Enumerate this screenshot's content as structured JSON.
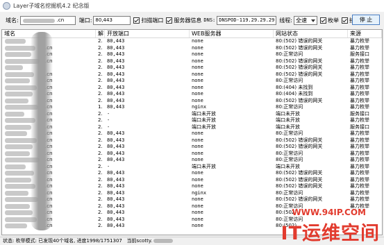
{
  "window": {
    "title": "Layer子域名挖掘机4.2 纪念版"
  },
  "toolbar": {
    "domain_label": "域名:",
    "domain_value": ".cn",
    "port_label": "端口:",
    "port_value": "80,443",
    "scan_ports_label": "扫描端口",
    "server_info_label": "服务器信息",
    "dns_label": "DNS:",
    "dns_value": "DNSPOD-119.29.29.29",
    "threads_label": "线程:",
    "threads_value": "全速",
    "enum_label": "枚举",
    "interface_label": "接口",
    "stop_label": "停 止"
  },
  "table": {
    "columns": [
      "域名",
      "解",
      "开放端口",
      "WEB服务器",
      "网站状态",
      "来源"
    ],
    "rows": [
      {
        "domain": "",
        "ip": "2.",
        "ports": "80,443",
        "server": "none",
        "status": "80:(502) 错误的网关",
        "source": "暴力枚举"
      },
      {
        "domain": ".cn",
        "ip": "2.",
        "ports": "80,443",
        "server": "none",
        "status": "80:(502) 错误的网关",
        "source": "暴力枚举"
      },
      {
        "domain": ".cn",
        "ip": "2.",
        "ports": "80,443",
        "server": "none",
        "status": "80:正常访问",
        "source": "服务接口"
      },
      {
        "domain": ".cn",
        "ip": "2.",
        "ports": "80,443",
        "server": "none",
        "status": "80:(502) 错误的网关",
        "source": "暴力枚举"
      },
      {
        "domain": "",
        "ip": "2.",
        "ports": "80,443",
        "server": "none",
        "status": "80:(502) 错误的网关",
        "source": "暴力枚举"
      },
      {
        "domain": ".cn",
        "ip": "2.",
        "ports": "80,443",
        "server": "none",
        "status": "80:(502) 错误的网关",
        "source": "暴力枚举"
      },
      {
        "domain": ".cn",
        "ip": "2.",
        "ports": "80,443",
        "server": "none",
        "status": "80:正常访问",
        "source": "暴力枚举"
      },
      {
        "domain": ".cn",
        "ip": "2.",
        "ports": "80,443",
        "server": "none",
        "status": "80:(404) 未找到",
        "source": "暴力枚举"
      },
      {
        "domain": ".cn",
        "ip": "2.",
        "ports": "80,443",
        "server": "none",
        "status": "80:(404) 未找到",
        "source": "暴力枚举"
      },
      {
        "domain": ".cn",
        "ip": "2.",
        "ports": "80,443",
        "server": "none",
        "status": "80:(502) 错误的网关",
        "source": "暴力枚举"
      },
      {
        "domain": ".cn",
        "ip": "1.",
        "ports": "80,443",
        "server": "nginx",
        "status": "80:正常访问",
        "source": "暴力枚举"
      },
      {
        "domain": ".cn",
        "ip": "2.",
        "ports": "-",
        "server": "端口未开放",
        "status": "端口未开放",
        "source": "服务接口"
      },
      {
        "domain": ".cn",
        "ip": "2.",
        "ports": "-",
        "server": "端口未开放",
        "status": "端口未开放",
        "source": "暴力枚举"
      },
      {
        "domain": ".cn",
        "ip": "2.",
        "ports": "-",
        "server": "端口未开放",
        "status": "端口未开放",
        "source": "服务接口"
      },
      {
        "domain": ".cn",
        "ip": "2.",
        "ports": "80,443",
        "server": "none",
        "status": "80:正常访问",
        "source": "暴力枚举"
      },
      {
        "domain": ".cn",
        "ip": "2.",
        "ports": "80,443",
        "server": "none",
        "status": "80:(502) 错误的网关",
        "source": "暴力枚举"
      },
      {
        "domain": ".cn",
        "ip": "2.",
        "ports": "80,443",
        "server": "none",
        "status": "80:(502) 错误的网关",
        "source": "暴力枚举"
      },
      {
        "domain": ".cn",
        "ip": "2.",
        "ports": "80,443",
        "server": "none",
        "status": "80:正常访问",
        "source": "暴力枚举"
      },
      {
        "domain": ".cn",
        "ip": "2.",
        "ports": "80,443",
        "server": "none",
        "status": "80:正常访问",
        "source": "暴力枚举"
      },
      {
        "domain": ".cn",
        "ip": "2.",
        "ports": "-",
        "server": "端口未开放",
        "status": "端口未开放",
        "source": "暴力枚举"
      },
      {
        "domain": ".cn",
        "ip": "2.",
        "ports": "80,443",
        "server": "none",
        "status": "80:(502) 错误的网关",
        "source": "暴力枚举"
      },
      {
        "domain": ".cn",
        "ip": "2.",
        "ports": "80,443",
        "server": "none",
        "status": "80:(502) 错误的网关",
        "source": "暴力枚举"
      },
      {
        "domain": ".cn",
        "ip": "2.",
        "ports": "80,443",
        "server": "none",
        "status": "80:(502) 错误的网关",
        "source": "暴力枚举"
      },
      {
        "domain": ".cn",
        "ip": "2.",
        "ports": "80,443",
        "server": "nginx",
        "status": "80:正常访问",
        "source": "暴力枚举"
      },
      {
        "domain": ".cn",
        "ip": "2.",
        "ports": "80,443",
        "server": "none",
        "status": "80:(502) 错误的网关",
        "source": "暴力枚举"
      },
      {
        "domain": ".cn",
        "ip": "2.",
        "ports": "80,443",
        "server": "none",
        "status": "80:正常访问",
        "source": "暴力枚举"
      },
      {
        "domain": ".cn",
        "ip": "2.",
        "ports": "80,443",
        "server": "none",
        "status": "80:(502)",
        "source": ""
      },
      {
        "domain": ".cn",
        "ip": "2.",
        "ports": "80,443",
        "server": "none",
        "status": "80:正常访问",
        "source": ""
      },
      {
        "domain": ".cn",
        "ip": "2.",
        "ports": "80,443",
        "server": "none",
        "status": "80:(502)",
        "source": ""
      }
    ]
  },
  "statusbar": {
    "text": "状态: 枚举模式: 已发现40个域名, 进度1998/1751307",
    "current_prefix": "当前scotty."
  },
  "watermark": {
    "url": "WWW.94IP.COM",
    "main": "IT运维空间"
  }
}
